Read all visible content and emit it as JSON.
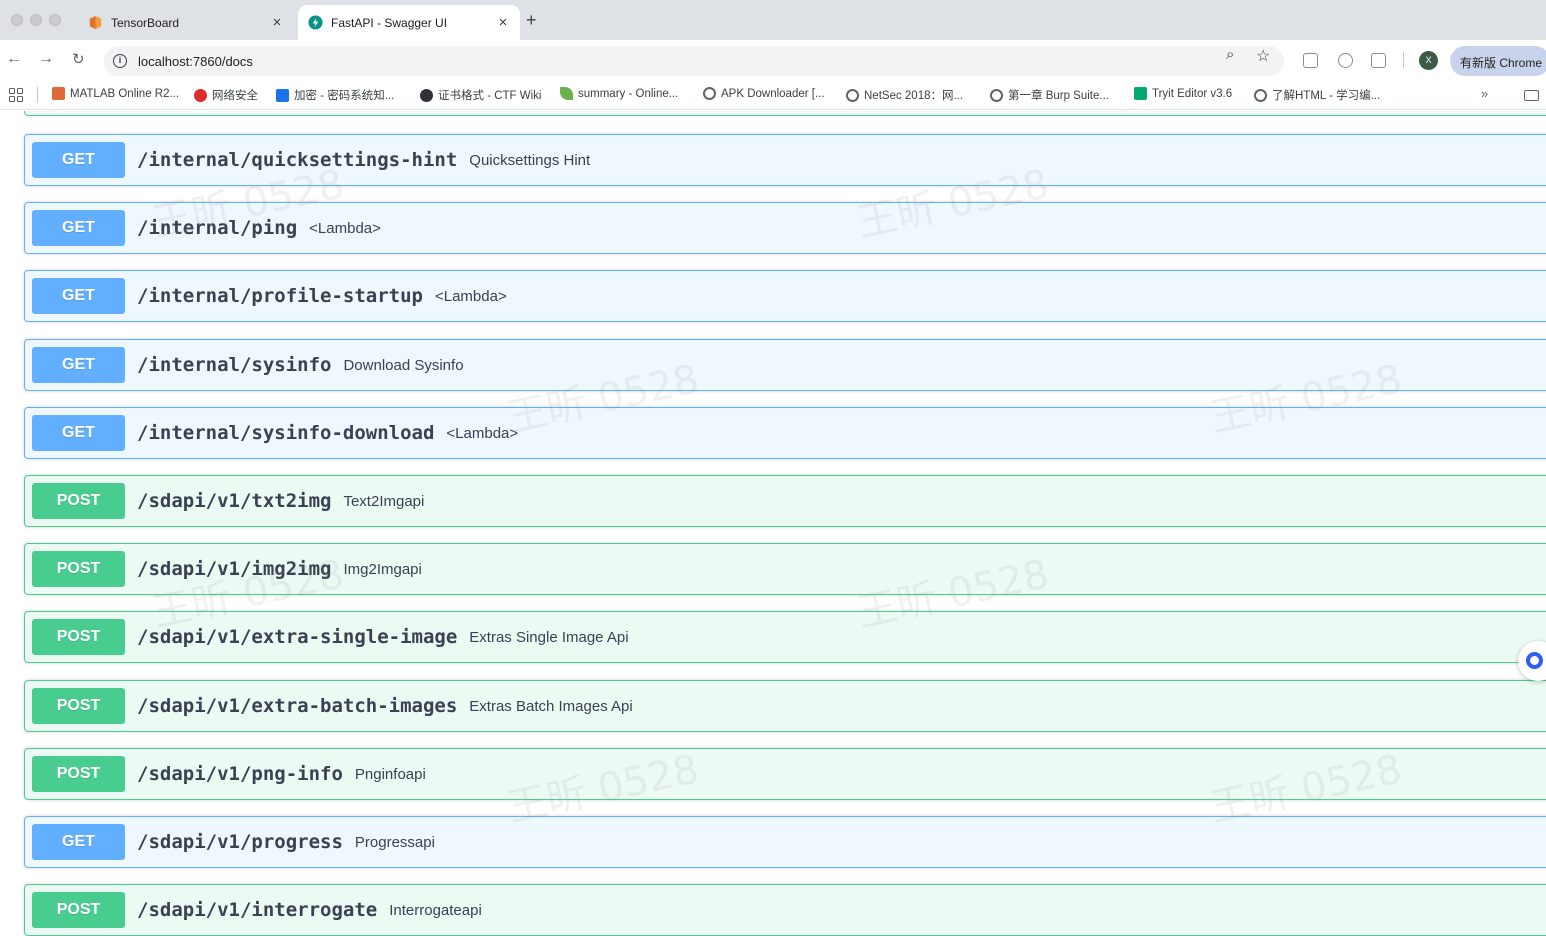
{
  "browser": {
    "tabs": [
      {
        "title": "TensorBoard",
        "icon": "tensorboard-icon",
        "active": false
      },
      {
        "title": "FastAPI - Swagger UI",
        "icon": "fastapi-icon",
        "active": true
      }
    ],
    "new_tab_label": "+",
    "close_glyph": "×",
    "url": "localhost:7860/docs",
    "profile_initial": "X",
    "update_label": "有新版 Chrome",
    "bookmarks": [
      {
        "label": "MATLAB Online R2...",
        "icon": "matlab-icon",
        "color": "#e16737"
      },
      {
        "label": "网络安全",
        "icon": "huawei-icon",
        "color": "#e02b2b"
      },
      {
        "label": "加密 - 密码系统知...",
        "icon": "document-icon",
        "color": "#1a73e8"
      },
      {
        "label": "证书格式 - CTF Wiki",
        "icon": "ctf-wiki-icon",
        "color": "#303134"
      },
      {
        "label": "summary - Online...",
        "icon": "leaf-icon",
        "color": "#6ab04c"
      },
      {
        "label": "APK Downloader [...",
        "icon": "globe-icon",
        "color": "#5f6368"
      },
      {
        "label": "NetSec 2018：网...",
        "icon": "globe-icon",
        "color": "#5f6368"
      },
      {
        "label": "第一章 Burp Suite...",
        "icon": "globe-icon",
        "color": "#5f6368"
      },
      {
        "label": "Tryit Editor v3.6",
        "icon": "w3schools-icon",
        "color": "#04aa6d"
      },
      {
        "label": "了解HTML - 学习编...",
        "icon": "globe-icon",
        "color": "#5f6368"
      }
    ],
    "more_label": "»"
  },
  "operations": [
    {
      "method": "GET",
      "path": "/internal/quicksettings-hint",
      "summary": "Quicksettings Hint"
    },
    {
      "method": "GET",
      "path": "/internal/ping",
      "summary": "<Lambda>"
    },
    {
      "method": "GET",
      "path": "/internal/profile-startup",
      "summary": "<Lambda>"
    },
    {
      "method": "GET",
      "path": "/internal/sysinfo",
      "summary": "Download Sysinfo"
    },
    {
      "method": "GET",
      "path": "/internal/sysinfo-download",
      "summary": "<Lambda>"
    },
    {
      "method": "POST",
      "path": "/sdapi/v1/txt2img",
      "summary": "Text2Imgapi"
    },
    {
      "method": "POST",
      "path": "/sdapi/v1/img2img",
      "summary": "Img2Imgapi"
    },
    {
      "method": "POST",
      "path": "/sdapi/v1/extra-single-image",
      "summary": "Extras Single Image Api"
    },
    {
      "method": "POST",
      "path": "/sdapi/v1/extra-batch-images",
      "summary": "Extras Batch Images Api"
    },
    {
      "method": "POST",
      "path": "/sdapi/v1/png-info",
      "summary": "Pnginfoapi"
    },
    {
      "method": "GET",
      "path": "/sdapi/v1/progress",
      "summary": "Progressapi"
    },
    {
      "method": "POST",
      "path": "/sdapi/v1/interrogate",
      "summary": "Interrogateapi"
    }
  ],
  "watermark": "王昕 0528",
  "colors": {
    "get": "#61affe",
    "post": "#49cc90"
  }
}
